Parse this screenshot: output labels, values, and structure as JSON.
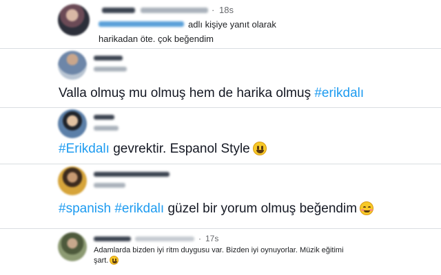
{
  "tweets": [
    {
      "time": "18s",
      "reply_suffix": "adlı kişiye yanıt olarak",
      "text": "harikadan öte.  çok beğendim"
    },
    {
      "text": "Valla olmuş mu olmuş hem de harika olmuş ",
      "hashtag": "#erikdalı"
    },
    {
      "hashtag": "#Erikdalı",
      "text": " gevrektir. Espanol Style",
      "emoji": "grinning-face-emoji"
    },
    {
      "hashtag1": "#spanish",
      "hashtag2": "#erikdalı",
      "text": " güzel bir yorum olmuş beğendim",
      "emoji": "smiling-face-emoji"
    },
    {
      "time": "17s",
      "text_line1": "Adamlarda bizden iyi ritm duygusu var. Bizden iyi oynuyorlar. Müzik eğitimi",
      "text_line2": "şart.",
      "emoji": "grinning-face-emoji"
    }
  ],
  "colors": {
    "hashtag": "#1d9bf0",
    "meta": "#65676b",
    "divider": "#d9dde1"
  }
}
